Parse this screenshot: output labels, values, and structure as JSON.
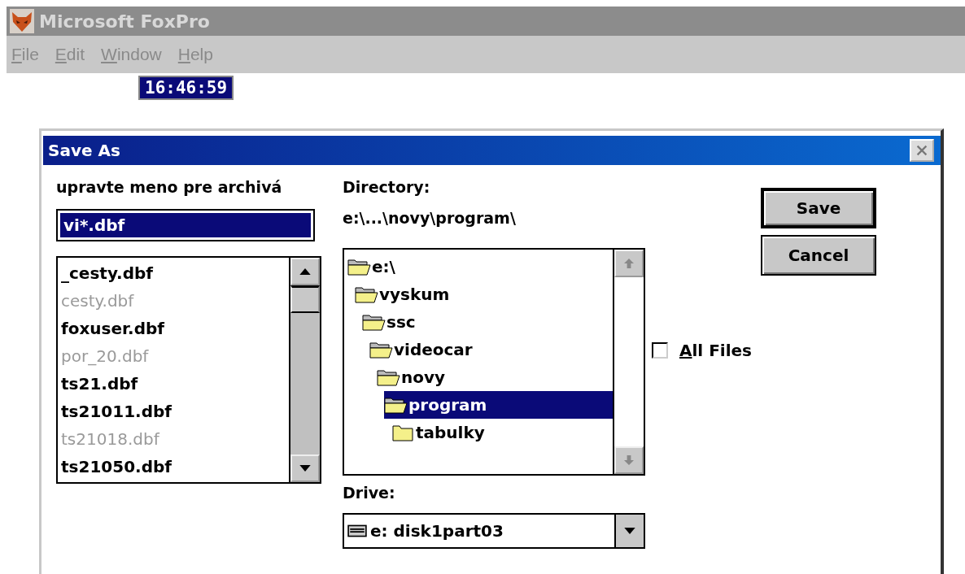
{
  "app": {
    "title": "Microsoft FoxPro"
  },
  "menu": [
    "File",
    "Edit",
    "Window",
    "Help"
  ],
  "clock": "16:46:59",
  "dialog": {
    "title": "Save As",
    "name_label": "upravte meno pre archivá",
    "name_value": "vi*.dbf",
    "files": [
      {
        "name": "_cesty.dbf",
        "disabled": false
      },
      {
        "name": "cesty.dbf",
        "disabled": true
      },
      {
        "name": "foxuser.dbf",
        "disabled": false
      },
      {
        "name": "por_20.dbf",
        "disabled": true
      },
      {
        "name": "ts21.dbf",
        "disabled": false
      },
      {
        "name": "ts21011.dbf",
        "disabled": false
      },
      {
        "name": "ts21018.dbf",
        "disabled": true
      },
      {
        "name": "ts21050.dbf",
        "disabled": false
      }
    ],
    "directory_label": "Directory:",
    "directory_path": "e:\\...\\novy\\program\\",
    "tree": [
      {
        "name": "e:\\",
        "expanded": true,
        "selected": false,
        "children": [
          {
            "name": "vyskum",
            "expanded": true,
            "selected": false,
            "children": [
              {
                "name": "ssc",
                "expanded": true,
                "selected": false,
                "children": [
                  {
                    "name": "videocar",
                    "expanded": true,
                    "selected": false,
                    "children": [
                      {
                        "name": "novy",
                        "expanded": true,
                        "selected": false,
                        "children": [
                          {
                            "name": "program",
                            "expanded": true,
                            "selected": true,
                            "children": [
                              {
                                "name": "tabulky",
                                "expanded": false,
                                "selected": false
                              }
                            ]
                          }
                        ]
                      }
                    ]
                  }
                ]
              }
            ]
          }
        ]
      }
    ],
    "drive_label": "Drive:",
    "drive_value": "e: disk1part03",
    "buttons": [
      {
        "label": "Save",
        "default": true
      },
      {
        "label": "Cancel",
        "default": false
      }
    ],
    "all_files": {
      "label": "All Files",
      "checked": false
    }
  }
}
